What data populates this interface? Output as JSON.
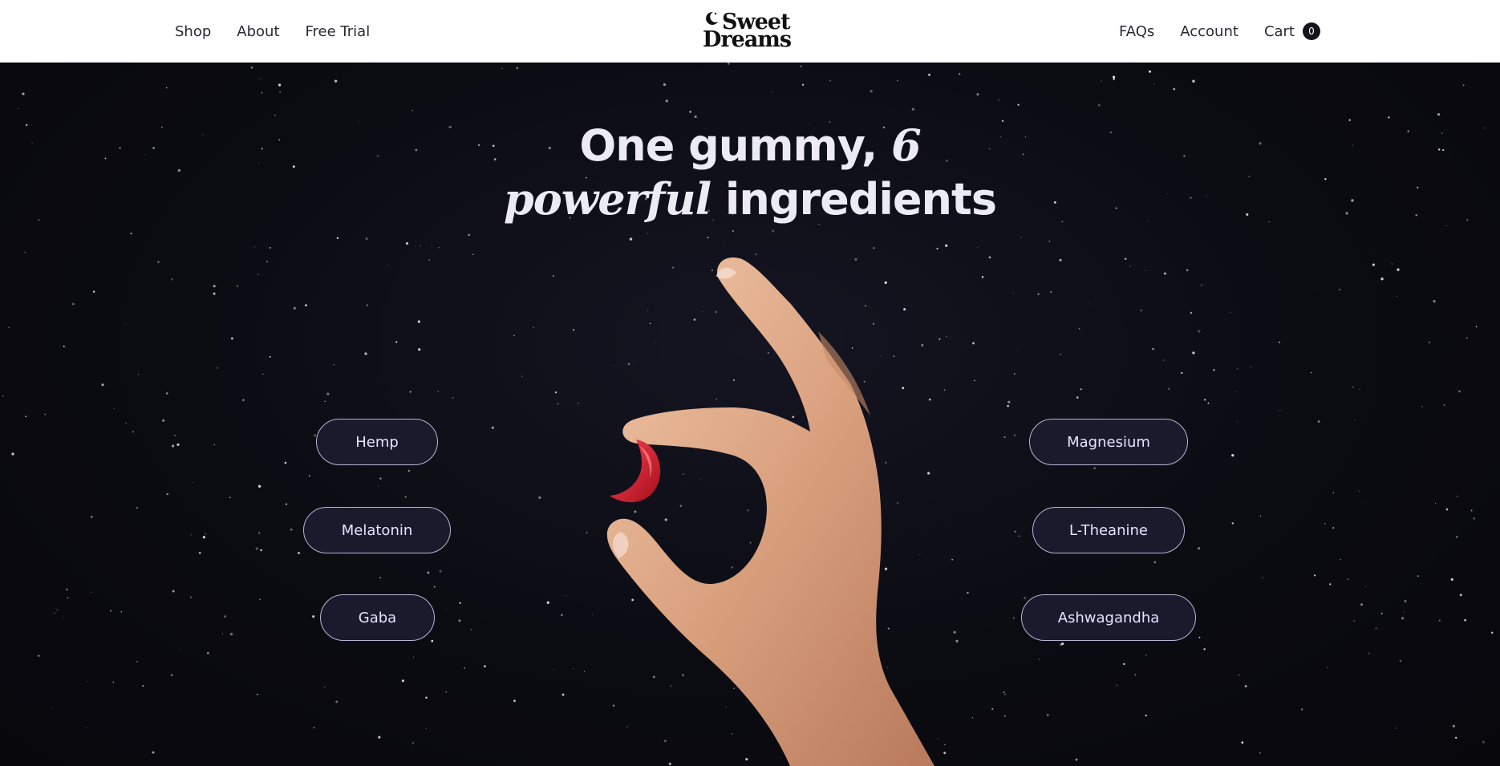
{
  "nav": {
    "left": [
      {
        "label": "Shop"
      },
      {
        "label": "About"
      },
      {
        "label": "Free Trial"
      }
    ],
    "right": [
      {
        "label": "FAQs"
      },
      {
        "label": "Account"
      }
    ],
    "cart_label": "Cart",
    "cart_count": "0"
  },
  "logo": {
    "line1": "Sweet",
    "line2": "Dreams",
    "icon": "crescent-moon-icon"
  },
  "hero": {
    "headline_part1": "One gummy, ",
    "headline_number": "6",
    "headline_emphasis": "powerful",
    "headline_part2": " ingredients",
    "ingredients_left": [
      "Hemp",
      "Melatonin",
      "Gaba"
    ],
    "ingredients_right": [
      "Magnesium",
      "L-Theanine",
      "Ashwagandha"
    ]
  },
  "colors": {
    "background": "#0b0b12",
    "pill_fill": "#1a1a2c",
    "pill_border": "#b9b5d6",
    "gummy": "#c81a2a"
  }
}
